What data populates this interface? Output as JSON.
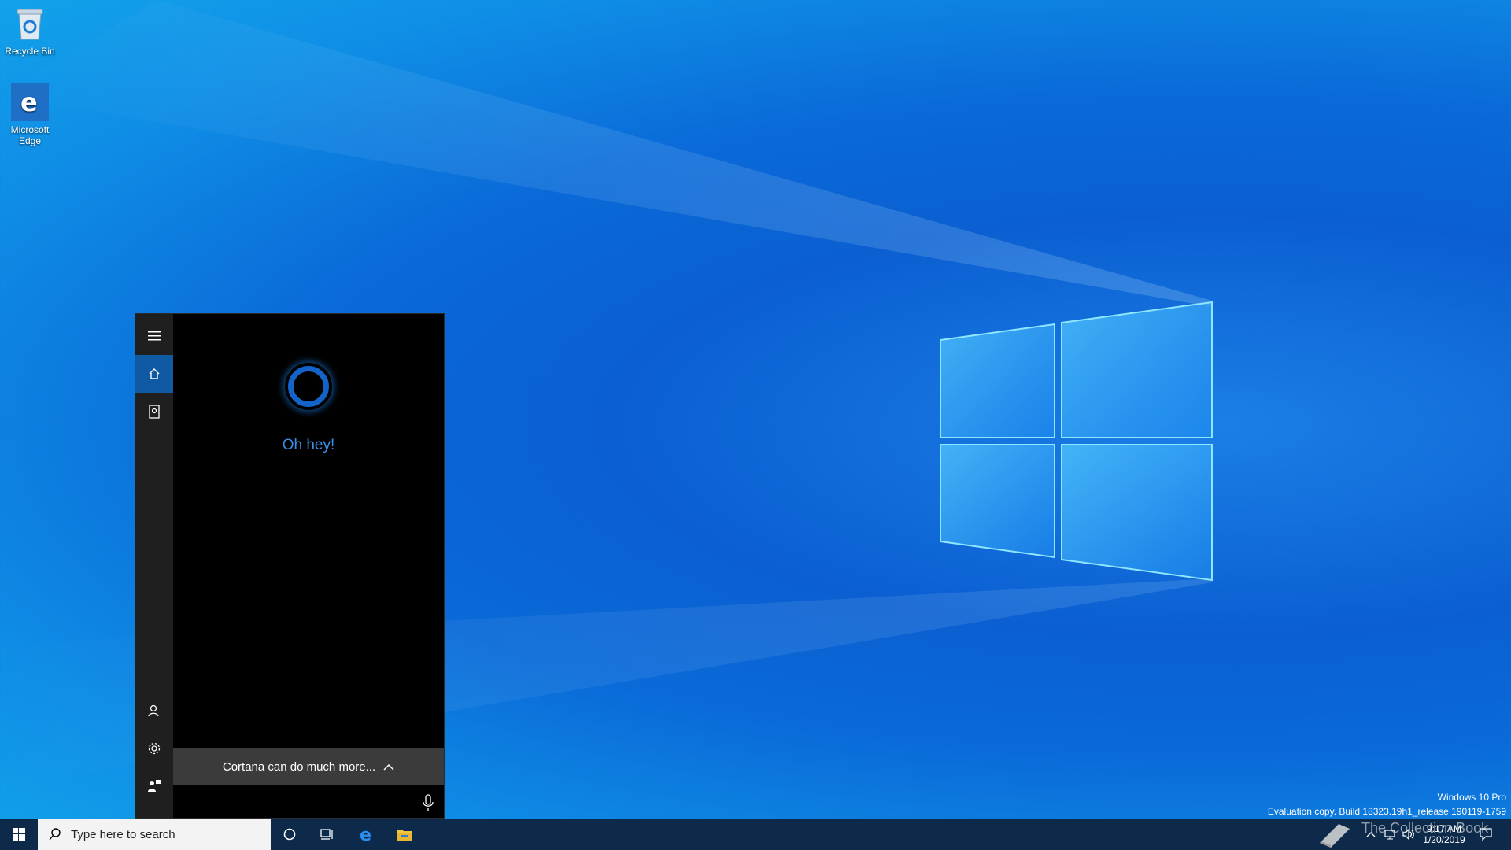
{
  "desktop": {
    "icons": [
      {
        "label": "Recycle Bin",
        "icon": "recycle-bin-icon"
      },
      {
        "label": "Microsoft Edge",
        "icon": "edge-icon"
      }
    ]
  },
  "cortana": {
    "greeting": "Oh hey!",
    "more_label": "Cortana can do much more...",
    "rail": [
      "menu-icon",
      "home-icon",
      "notebook-icon",
      "account-icon",
      "settings-icon",
      "feedback-icon"
    ]
  },
  "taskbar": {
    "search_placeholder": "Type here to search",
    "time": "9:17 AM",
    "date": "1/20/2019"
  },
  "watermark": {
    "line1": "Windows 10 Pro",
    "line2": "Evaluation copy. Build 18323.19h1_release.190119-1759"
  },
  "overlay": {
    "brand": "The Collection Book"
  },
  "colors": {
    "accent": "#0f5aa3",
    "cortana_ring": "#1363c8",
    "greeting": "#3b8ee6",
    "taskbar": "#0d2a4b"
  }
}
